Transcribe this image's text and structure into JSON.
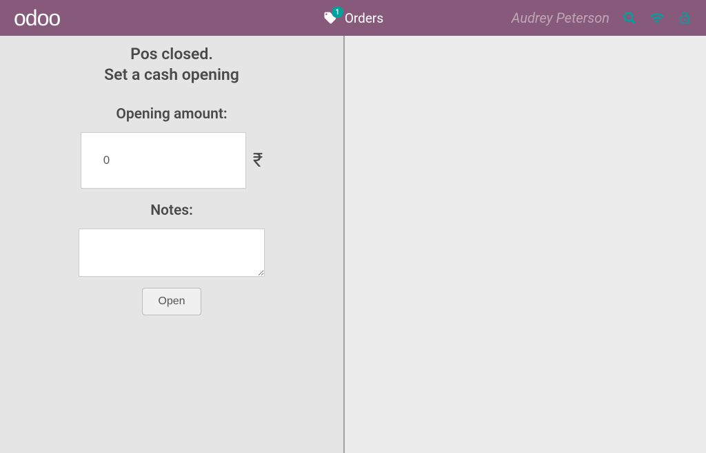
{
  "header": {
    "logo_text": "odoo",
    "orders_label": "Orders",
    "orders_badge": "1",
    "username": "Audrey Peterson"
  },
  "panel": {
    "title_line1": "Pos closed.",
    "title_line2": "Set a cash opening",
    "opening_amount_label": "Opening amount:",
    "opening_amount_value": "0",
    "currency_symbol": "₹",
    "notes_label": "Notes:",
    "notes_value": "",
    "open_button_label": "Open"
  }
}
